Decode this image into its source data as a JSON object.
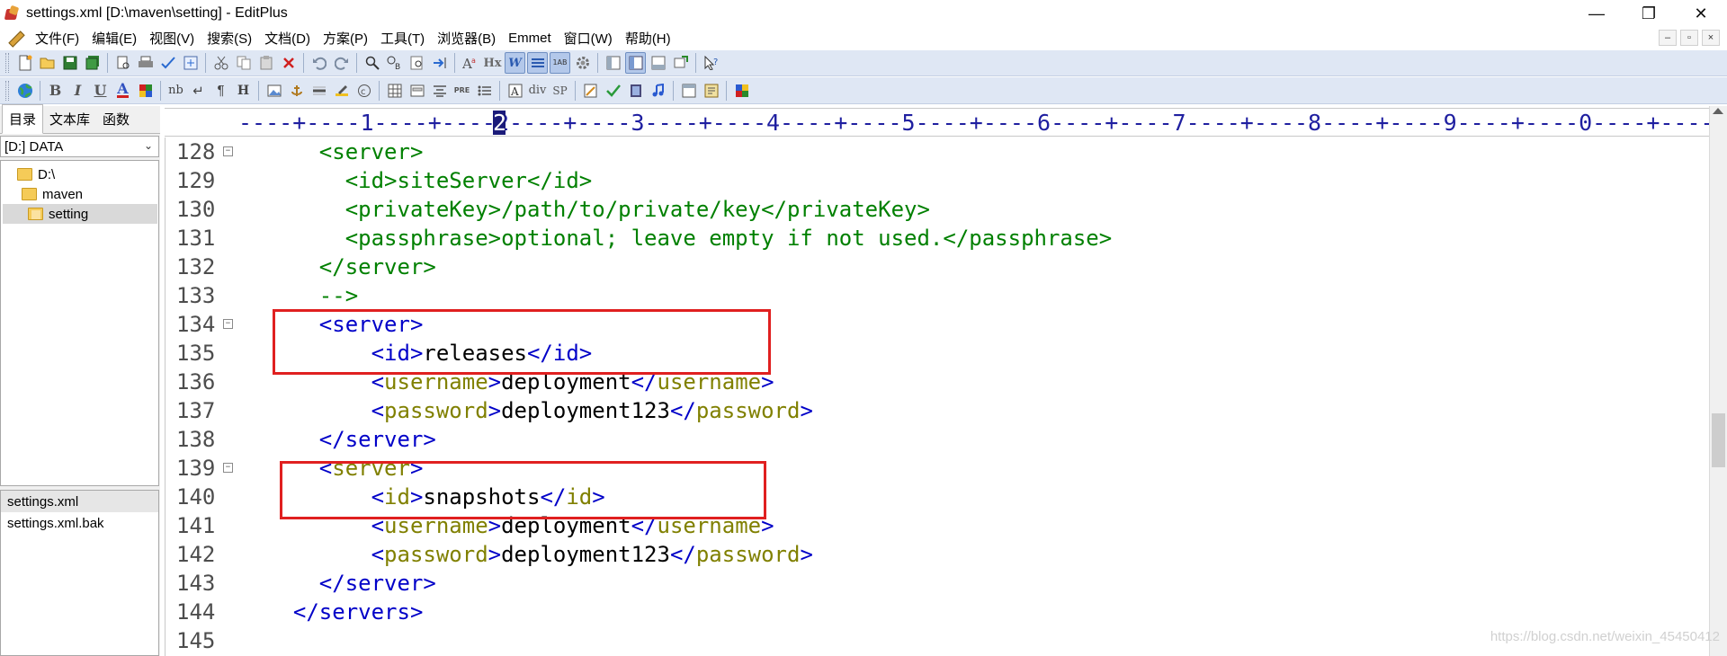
{
  "window": {
    "title": "settings.xml [D:\\maven\\setting] - EditPlus",
    "minimize": "—",
    "maximize": "❐",
    "close": "✕"
  },
  "menu": [
    "文件(F)",
    "编辑(E)",
    "视图(V)",
    "搜索(S)",
    "文档(D)",
    "方案(P)",
    "工具(T)",
    "浏览器(B)",
    "Emmet",
    "窗口(W)",
    "帮助(H)"
  ],
  "mdi": {
    "minimize": "–",
    "restore": "▫",
    "close": "×"
  },
  "toolbar2_labels": {
    "bold": "B",
    "italic": "I",
    "underline": "U",
    "font_color": "A",
    "nbsp": "nb",
    "break": "↵",
    "para": "¶",
    "heading": "H",
    "div": "div",
    "sp": "SP",
    "pre": "PRE"
  },
  "toolbar1_labels": {
    "hx": "Hx",
    "w": "W",
    "abcd": "1AB"
  },
  "left_panel": {
    "tabs": [
      "目录",
      "文本库",
      "函数"
    ],
    "drive": "[D:] DATA",
    "tree": [
      {
        "label": "D:\\",
        "indent": 0,
        "open": false
      },
      {
        "label": "maven",
        "indent": 1,
        "open": false
      },
      {
        "label": "setting",
        "indent": 2,
        "open": true
      }
    ],
    "selected_folder": "setting",
    "files": [
      "settings.xml",
      "settings.xml.bak"
    ],
    "selected_file": "settings.xml"
  },
  "ruler": {
    "text": "----+----1----+----2----+----3----+----4----+----5----+----6----+----7----+----8----+----9----+----0----+----",
    "cursor_column": "2"
  },
  "editor": {
    "lines": [
      {
        "num": "128",
        "fold": true,
        "segments": [
          [
            "    ",
            "t"
          ],
          [
            "<server>",
            "cm"
          ]
        ]
      },
      {
        "num": "129",
        "fold": false,
        "segments": [
          [
            "      ",
            "t"
          ],
          [
            "<id>siteServer</id>",
            "cm"
          ]
        ]
      },
      {
        "num": "130",
        "fold": false,
        "segments": [
          [
            "      ",
            "t"
          ],
          [
            "<privateKey>/path/to/private/key</privateKey>",
            "cm"
          ]
        ]
      },
      {
        "num": "131",
        "fold": false,
        "segments": [
          [
            "      ",
            "t"
          ],
          [
            "<passphrase>optional; leave empty if not used.</passphrase>",
            "cm"
          ]
        ]
      },
      {
        "num": "132",
        "fold": false,
        "segments": [
          [
            "    ",
            "t"
          ],
          [
            "</server>",
            "cm"
          ]
        ]
      },
      {
        "num": "133",
        "fold": false,
        "segments": [
          [
            "    ",
            "t"
          ],
          [
            "-->",
            "cm"
          ]
        ]
      },
      {
        "num": "134",
        "fold": true,
        "segments": [
          [
            "    ",
            "t"
          ],
          [
            "<server>",
            "tag"
          ]
        ]
      },
      {
        "num": "135",
        "fold": false,
        "segments": [
          [
            "        ",
            "t"
          ],
          [
            "<id>",
            "tag"
          ],
          [
            "releases",
            "t"
          ],
          [
            "</id>",
            "tag"
          ]
        ]
      },
      {
        "num": "136",
        "fold": false,
        "segments": [
          [
            "        ",
            "t"
          ],
          [
            "<",
            "tag"
          ],
          [
            "username",
            "attr"
          ],
          [
            ">",
            "tag"
          ],
          [
            "deployment",
            "t"
          ],
          [
            "</",
            "tag"
          ],
          [
            "username",
            "attr"
          ],
          [
            ">",
            "tag"
          ]
        ]
      },
      {
        "num": "137",
        "fold": false,
        "segments": [
          [
            "        ",
            "t"
          ],
          [
            "<",
            "tag"
          ],
          [
            "password",
            "attr"
          ],
          [
            ">",
            "tag"
          ],
          [
            "deployment123",
            "t"
          ],
          [
            "</",
            "tag"
          ],
          [
            "password",
            "attr"
          ],
          [
            ">",
            "tag"
          ]
        ]
      },
      {
        "num": "138",
        "fold": false,
        "segments": [
          [
            "    ",
            "t"
          ],
          [
            "</server>",
            "tag"
          ]
        ]
      },
      {
        "num": "139",
        "fold": true,
        "segments": [
          [
            "    ",
            "t"
          ],
          [
            "<",
            "tag"
          ],
          [
            "server",
            "attr"
          ],
          [
            ">",
            "tag"
          ]
        ]
      },
      {
        "num": "140",
        "fold": false,
        "segments": [
          [
            "        ",
            "t"
          ],
          [
            "<",
            "tag"
          ],
          [
            "id",
            "attr"
          ],
          [
            ">",
            "tag"
          ],
          [
            "snapshots",
            "t"
          ],
          [
            "</",
            "tag"
          ],
          [
            "id",
            "attr"
          ],
          [
            ">",
            "tag"
          ]
        ]
      },
      {
        "num": "141",
        "fold": false,
        "segments": [
          [
            "        ",
            "t"
          ],
          [
            "<",
            "tag"
          ],
          [
            "username",
            "attr"
          ],
          [
            ">",
            "tag"
          ],
          [
            "deployment",
            "t"
          ],
          [
            "</",
            "tag"
          ],
          [
            "username",
            "attr"
          ],
          [
            ">",
            "tag"
          ]
        ]
      },
      {
        "num": "142",
        "fold": false,
        "segments": [
          [
            "        ",
            "t"
          ],
          [
            "<",
            "tag"
          ],
          [
            "password",
            "attr"
          ],
          [
            ">",
            "tag"
          ],
          [
            "deployment123",
            "t"
          ],
          [
            "</",
            "tag"
          ],
          [
            "password",
            "attr"
          ],
          [
            ">",
            "tag"
          ]
        ]
      },
      {
        "num": "143",
        "fold": false,
        "segments": [
          [
            "    ",
            "t"
          ],
          [
            "</server>",
            "tag"
          ]
        ]
      },
      {
        "num": "144",
        "fold": false,
        "segments": [
          [
            "  ",
            "t"
          ],
          [
            "</servers>",
            "tag"
          ]
        ]
      },
      {
        "num": "145",
        "fold": false,
        "segments": []
      }
    ]
  },
  "watermark": "https://blog.csdn.net/weixin_45450412",
  "colors": {
    "comment": "#008000",
    "tag": "#0000c8",
    "attr": "#808000",
    "highlight_box": "#e02020",
    "toolbar_bg": "#dfe7f4"
  }
}
